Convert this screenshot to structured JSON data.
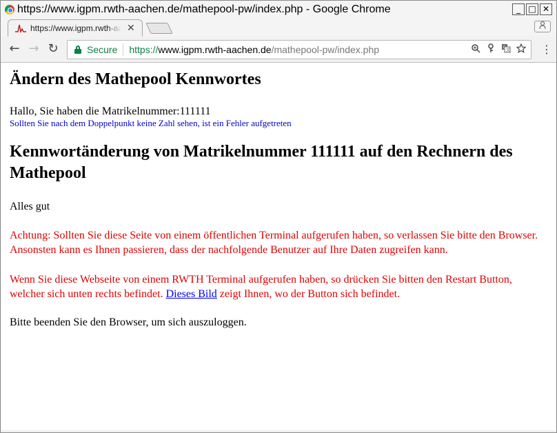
{
  "window": {
    "title": "https://www.igpm.rwth-aachen.de/mathepool-pw/index.php - Google Chrome",
    "controls": {
      "minimize": "_",
      "maximize": "□",
      "close": "✕"
    }
  },
  "tabs": [
    {
      "title": "https://www.igpm.rwth-aachen.de/mathepool-pw/index.php",
      "close": "✕"
    }
  ],
  "toolbar": {
    "back": "←",
    "forward": "→",
    "reload": "↻",
    "secure_label": "Secure",
    "url": {
      "scheme": "https://",
      "host": "www.igpm.rwth-aachen.de",
      "path": "/mathepool-pw/index.php"
    },
    "icons": [
      "zoom-icon",
      "key-icon",
      "translate-icon",
      "star-icon"
    ],
    "menu": "⋮"
  },
  "colors": {
    "secure_green": "#0b8043",
    "warning_red": "#e00000",
    "note_blue": "#0000cc",
    "link_blue": "#0000ee"
  },
  "page": {
    "heading": "Ändern des Mathepool Kennwortes",
    "greeting": "Hallo, Sie haben die Matrikelnummer:111111",
    "greeting_note": "Sollten Sie nach dem Doppelpunkt keine Zahl sehen, ist ein Fehler aufgetreten",
    "section_heading": "Kennwortänderung von Matrikelnummer 111111 auf den Rechnern des Mathepool",
    "status": "Alles gut",
    "warning_public": "Achtung: Sollten Sie diese Seite von einem öffentlichen Terminal aufgerufen haben, so verlassen Sie bitte den Browser. Ansonsten kann es Ihnen passieren, dass der nachfolgende Benutzer auf Ihre Daten zugreifen kann.",
    "warning_rwth_before": "Wenn Sie diese Webseite von einem RWTH Terminal aufgerufen haben, so drücken Sie bitten den Restart Button, welcher sich unten rechts befindet. ",
    "warning_rwth_link": "Dieses Bild",
    "warning_rwth_after": " zeigt Ihnen, wo der Button sich befindet.",
    "logout_note": "Bitte beenden Sie den Browser, um sich auszuloggen."
  }
}
